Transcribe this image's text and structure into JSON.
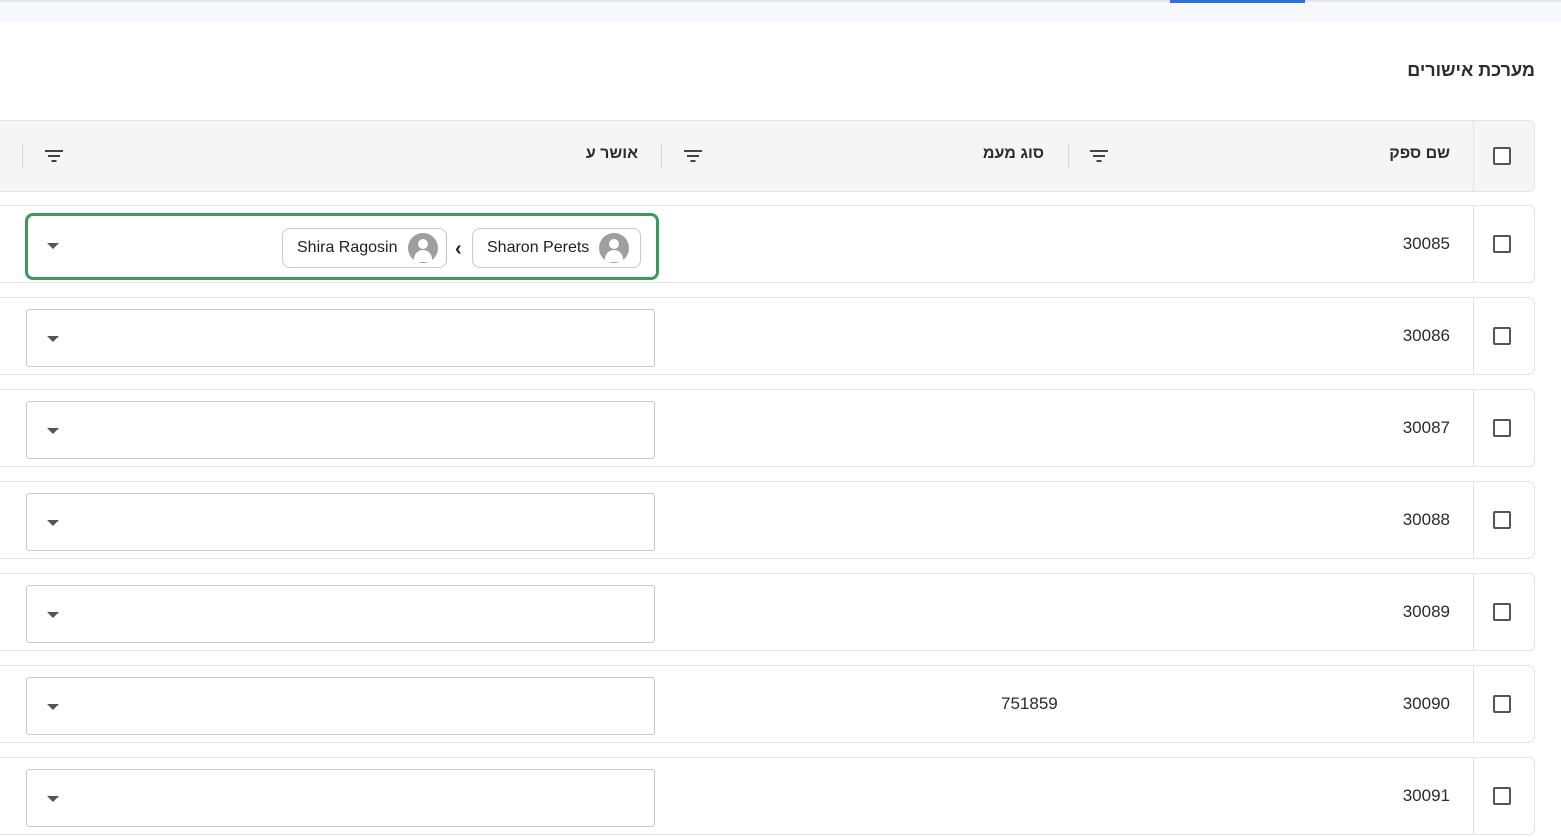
{
  "page": {
    "title": "מערכת אישורים"
  },
  "table": {
    "columns": [
      {
        "key": "supplier_name",
        "label": "שם ספק"
      },
      {
        "key": "vat_type",
        "label": "סוג מעמ"
      },
      {
        "key": "approved_by",
        "label": "אושר ע"
      }
    ],
    "rows": [
      {
        "id": "30085",
        "vat_type": "",
        "approvers": [
          "Sharon Perets",
          "Shira Ragosin"
        ]
      },
      {
        "id": "30086",
        "vat_type": "",
        "approvers": []
      },
      {
        "id": "30087",
        "vat_type": "",
        "approvers": []
      },
      {
        "id": "30088",
        "vat_type": "",
        "approvers": []
      },
      {
        "id": "30089",
        "vat_type": "",
        "approvers": []
      },
      {
        "id": "30090",
        "vat_type": "751859",
        "approvers": []
      },
      {
        "id": "30091",
        "vat_type": "",
        "approvers": []
      }
    ]
  },
  "colors": {
    "accent": "#2f6fd6",
    "selection_border": "#3a9a5b",
    "header_bg": "#f5f5f5"
  },
  "icons": {
    "filter": "filter-icon",
    "avatar": "person-avatar-icon",
    "caret": "caret-down-icon",
    "chevron": "chevron-left-icon"
  }
}
